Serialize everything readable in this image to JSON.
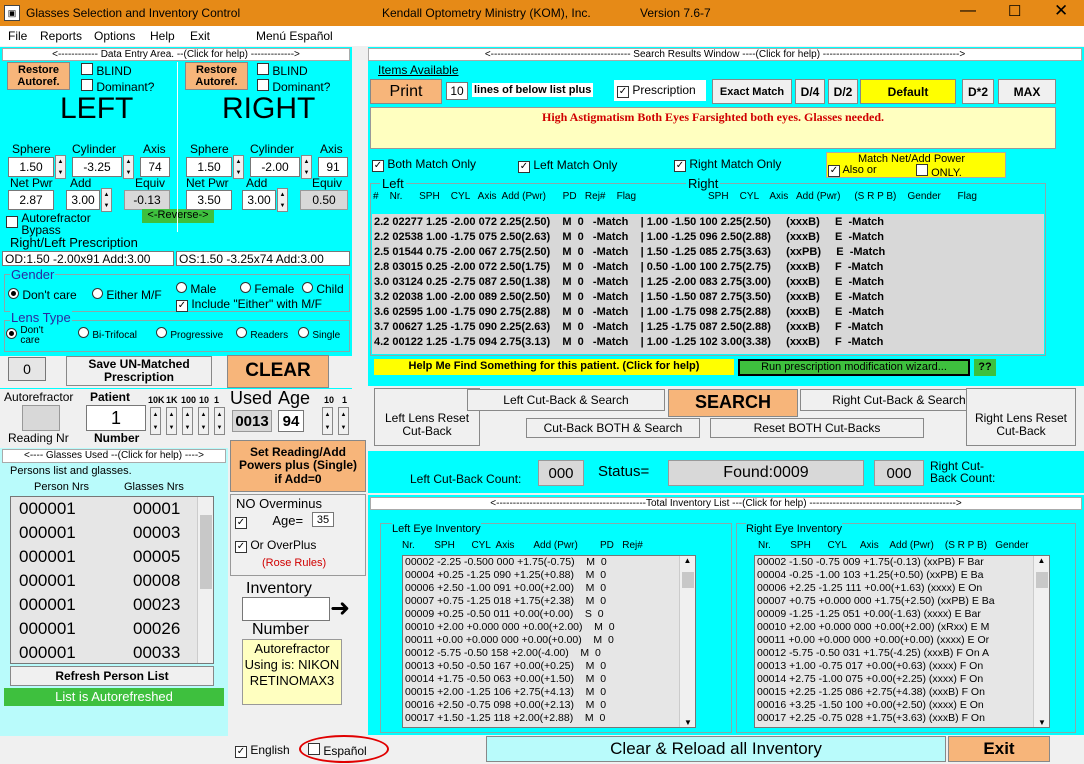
{
  "window": {
    "title": "Glasses Selection and Inventory Control",
    "center": "Kendall Optometry Ministry (KOM), Inc.",
    "version": "Version 7.6-7"
  },
  "menu": [
    "File",
    "Reports",
    "Options",
    "Help",
    "Exit",
    "Menú Español"
  ],
  "entry": {
    "header": "<------------ Data Entry Area. --(Click for help) ------------->",
    "restore": "Restore Autoref.",
    "blind": "BLIND",
    "dominant": "Dominant?",
    "left_title": "LEFT",
    "right_title": "RIGHT",
    "sphere": "Sphere",
    "cylinder": "Cylinder",
    "axis": "Axis",
    "netpwr": "Net Pwr",
    "add": "Add",
    "equiv": "Equiv",
    "left": {
      "sphere": "1.50",
      "cyl": "-3.25",
      "axis": "74",
      "net": "2.87",
      "add": "3.00",
      "equiv": "-0.13"
    },
    "right": {
      "sphere": "1.50",
      "cyl": "-2.00",
      "axis": "91",
      "net": "3.50",
      "add": "3.00",
      "equiv": "0.50"
    },
    "autoref_bypass": "Autorefractor Bypass",
    "reverse": "<-Reverse->",
    "rx_title": "Right/Left Prescription",
    "od": "OD:1.50  -2.00x91 Add:3.00",
    "os": "OS:1.50  -3.25x74 Add:3.00",
    "gender_title": "Gender",
    "dont_care": "Don't care",
    "either": "Either M/F",
    "male": "Male",
    "female": "Female",
    "child": "Child",
    "include_either": "Include \"Either\" with M/F",
    "lens_title": "Lens Type",
    "lens_dont": "Don't care",
    "bifocal": "Bi-Trifocal",
    "progressive": "Progressive",
    "readers": "Readers",
    "single": "Single",
    "zero": "0",
    "save_unmatched": "Save UN-Matched Prescription",
    "clear": "CLEAR",
    "autorefractor": "Autorefractor",
    "reading_nr": "Reading Nr",
    "patient": "Patient",
    "patient_val": "1",
    "number": "Number",
    "digits": [
      "10K",
      "1K",
      "100",
      "10",
      "1"
    ],
    "used": "Used",
    "used_val": "0013",
    "age": "Age",
    "age_val": "94",
    "age_digits": [
      "10",
      "1"
    ]
  },
  "glasses_used": {
    "header": "<---- Glasses Used --(Click for help) ---->",
    "sub": "Persons list and glasses.",
    "col1": "Person Nrs",
    "col2": "Glasses Nrs",
    "rows": [
      [
        "000001",
        "00001"
      ],
      [
        "000001",
        "00003"
      ],
      [
        "000001",
        "00005"
      ],
      [
        "000001",
        "00008"
      ],
      [
        "000001",
        "00023"
      ],
      [
        "000001",
        "00026"
      ],
      [
        "000001",
        "00033"
      ]
    ],
    "refresh": "Refresh Person List",
    "status": "List is Autorefreshed"
  },
  "middle": {
    "set_reading": "Set Reading/Add Powers plus (Single) if Add=0",
    "no_overminus": "NO Overminus",
    "age_lbl": "Age=",
    "age_val": "35",
    "or_overplus": "Or OverPlus",
    "rose": "(Rose Rules)",
    "inventory": "Inventory",
    "number": "Number",
    "autoref_info": "Autorefractor Using is: NIKON RETINOMAX3"
  },
  "lang": {
    "english": "English",
    "espanol": "Español"
  },
  "search": {
    "header": "<------------------------------------------ Search Results Window ----(Click for help) ----------------------------------------->",
    "items": "Items Available",
    "print": "Print",
    "lines_val": "10",
    "lines_text": "lines of below list plus",
    "prescription": "Prescription",
    "exact": "Exact Match",
    "d4": "D/4",
    "d2": "D/2",
    "default": "Default",
    "dx2": "D*2",
    "max": "MAX",
    "message": "High Astigmatism Both Eyes Farsighted both eyes. Glasses needed.",
    "both_match": "Both Match Only",
    "left_match": "Left Match Only",
    "right_match": "Right Match Only",
    "match_net": "Match Net/Add Power",
    "also_or": "Also or",
    "only": "ONLY.",
    "left_hdr": "Left",
    "right_hdr": "Right",
    "cols_left": "#    Nr.      SPH    CYL   Axis  Add (Pwr)      PD   Rej#    Flag",
    "cols_right": "SPH    CYL    Axis   Add (Pwr)     (S R P B)    Gender      Flag",
    "rows": [
      "2.2 02277 1.25 -2.00 072 2.25(2.50)    M  0   -Match    | 1.00 -1.50 100 2.25(2.50)     (xxxB)     E  -Match",
      "2.2 02538 1.00 -1.75 075 2.50(2.63)    M  0   -Match    | 1.00 -1.25 096 2.50(2.88)     (xxxB)     E  -Match",
      "2.5 01544 0.75 -2.00 067 2.75(2.50)    M  0   -Match    | 1.50 -1.25 085 2.75(3.63)     (xxPB)     E  -Match",
      "2.8 03015 0.25 -2.00 072 2.50(1.75)    M  0   -Match    | 0.50 -1.00 100 2.75(2.75)     (xxxB)     F  -Match",
      "3.0 03124 0.25 -2.75 087 2.50(1.38)    M  0   -Match    | 1.25 -2.00 083 2.75(3.00)     (xxxB)     E  -Match",
      "3.2 02038 1.00 -2.00 089 2.50(2.50)    M  0   -Match    | 1.50 -1.50 087 2.75(3.50)     (xxxB)     E  -Match",
      "3.6 02595 1.00 -1.75 090 2.75(2.88)    M  0   -Match    | 1.00 -1.75 098 2.75(2.88)     (xxxB)     E  -Match",
      "3.7 00627 1.25 -1.75 090 2.25(2.63)    M  0   -Match    | 1.25 -1.75 087 2.50(2.88)     (xxxB)     F  -Match",
      "4.2 00122 1.25 -1.75 094 2.75(3.13)    M  0   -Match    | 1.00 -1.25 102 3.00(3.38)     (xxxB)     F  -Match"
    ],
    "help_me": "Help Me Find Something for this patient. (Click for help)",
    "wizard": "Run prescription modification wizard...",
    "qq": "??",
    "left_lens_reset": "Left Lens Reset Cut-Back",
    "left_cut": "Left Cut-Back & Search",
    "search": "SEARCH",
    "right_cut": "Right Cut-Back & Search",
    "right_lens_reset": "Right Lens Reset Cut-Back",
    "cut_both": "Cut-Back BOTH & Search",
    "reset_both": "Reset BOTH Cut-Backs",
    "left_count_lbl": "Left Cut-Back Count:",
    "left_count": "000",
    "status_lbl": "Status=",
    "status_val": "Found:0009",
    "right_count": "000",
    "right_count_lbl": "Right Cut- Back Count:"
  },
  "inventory": {
    "header": "<---------------------------------------------Total Inventory List ---(Click for help) -------------------------------------------->",
    "left_title": "Left Eye Inventory",
    "right_title": "Right Eye Inventory",
    "left_cols": "Nr.       SPH      CYL  Axis       Add (Pwr)        PD   Rej#",
    "right_cols": "Nr.       SPH      CYL     Axis    Add (Pwr)    (S R P B)   Gender",
    "left_rows": [
      "00002 -2.25 -0.500 000 +1.75(-0.75)    M  0",
      "00004 +0.25 -1.25 090 +1.25(+0.88)    M  0",
      "00006 +2.50 -1.00 091 +0.00(+2.00)    M  0",
      "00007 +0.75 -1.25 018 +1.75(+2.38)    M  0",
      "00009 +0.25 -0.50 011 +0.00(+0.00)    S  0",
      "00010 +2.00 +0.000 000 +0.00(+2.00)    M  0",
      "00011 +0.00 +0.000 000 +0.00(+0.00)    M  0",
      "00012 -5.75 -0.50 158 +2.00(-4.00)    M  0",
      "00013 +0.50 -0.50 167 +0.00(+0.25)    M  0",
      "00014 +1.75 -0.50 063 +0.00(+1.50)    M  0",
      "00015 +2.00 -1.25 106 +2.75(+4.13)    M  0",
      "00016 +2.50 -0.75 098 +0.00(+2.13)    M  0",
      "00017 +1.50 -1.25 118 +2.00(+2.88)    M  0"
    ],
    "right_rows": [
      "00002 -1.50 -0.75 009 +1.75(-0.13) (xxPB) F Bar",
      "00004 -0.25 -1.00 103 +1.25(+0.50) (xxPB) E Ba",
      "00006 +2.25 -1.25 111 +0.00(+1.63) (xxxx) E On",
      "00007 +0.75 +0.000 000 +1.75(+2.50) (xxPB) E Ba",
      "00009 -1.25 -1.25 051 +0.00(-1.63) (xxxx) E Bar",
      "00010 +2.00 +0.000 000 +0.00(+2.00) (xRxx) E M",
      "00011 +0.00 +0.000 000 +0.00(+0.00) (xxxx) E Or",
      "00012 -5.75 -0.50 031 +1.75(-4.25) (xxxB) F On A",
      "00013 +1.00 -0.75 017 +0.00(+0.63) (xxxx) F On",
      "00014 +2.75 -1.00 075 +0.00(+2.25) (xxxx) F On",
      "00015 +2.25 -1.25 086 +2.75(+4.38) (xxxB) F On",
      "00016 +3.25 -1.50 100 +0.00(+2.50) (xxxx) E On",
      "00017 +2.25 -0.75 028 +1.75(+3.63) (xxxB) F On"
    ],
    "clear_reload": "Clear &  Reload all Inventory",
    "exit": "Exit"
  }
}
